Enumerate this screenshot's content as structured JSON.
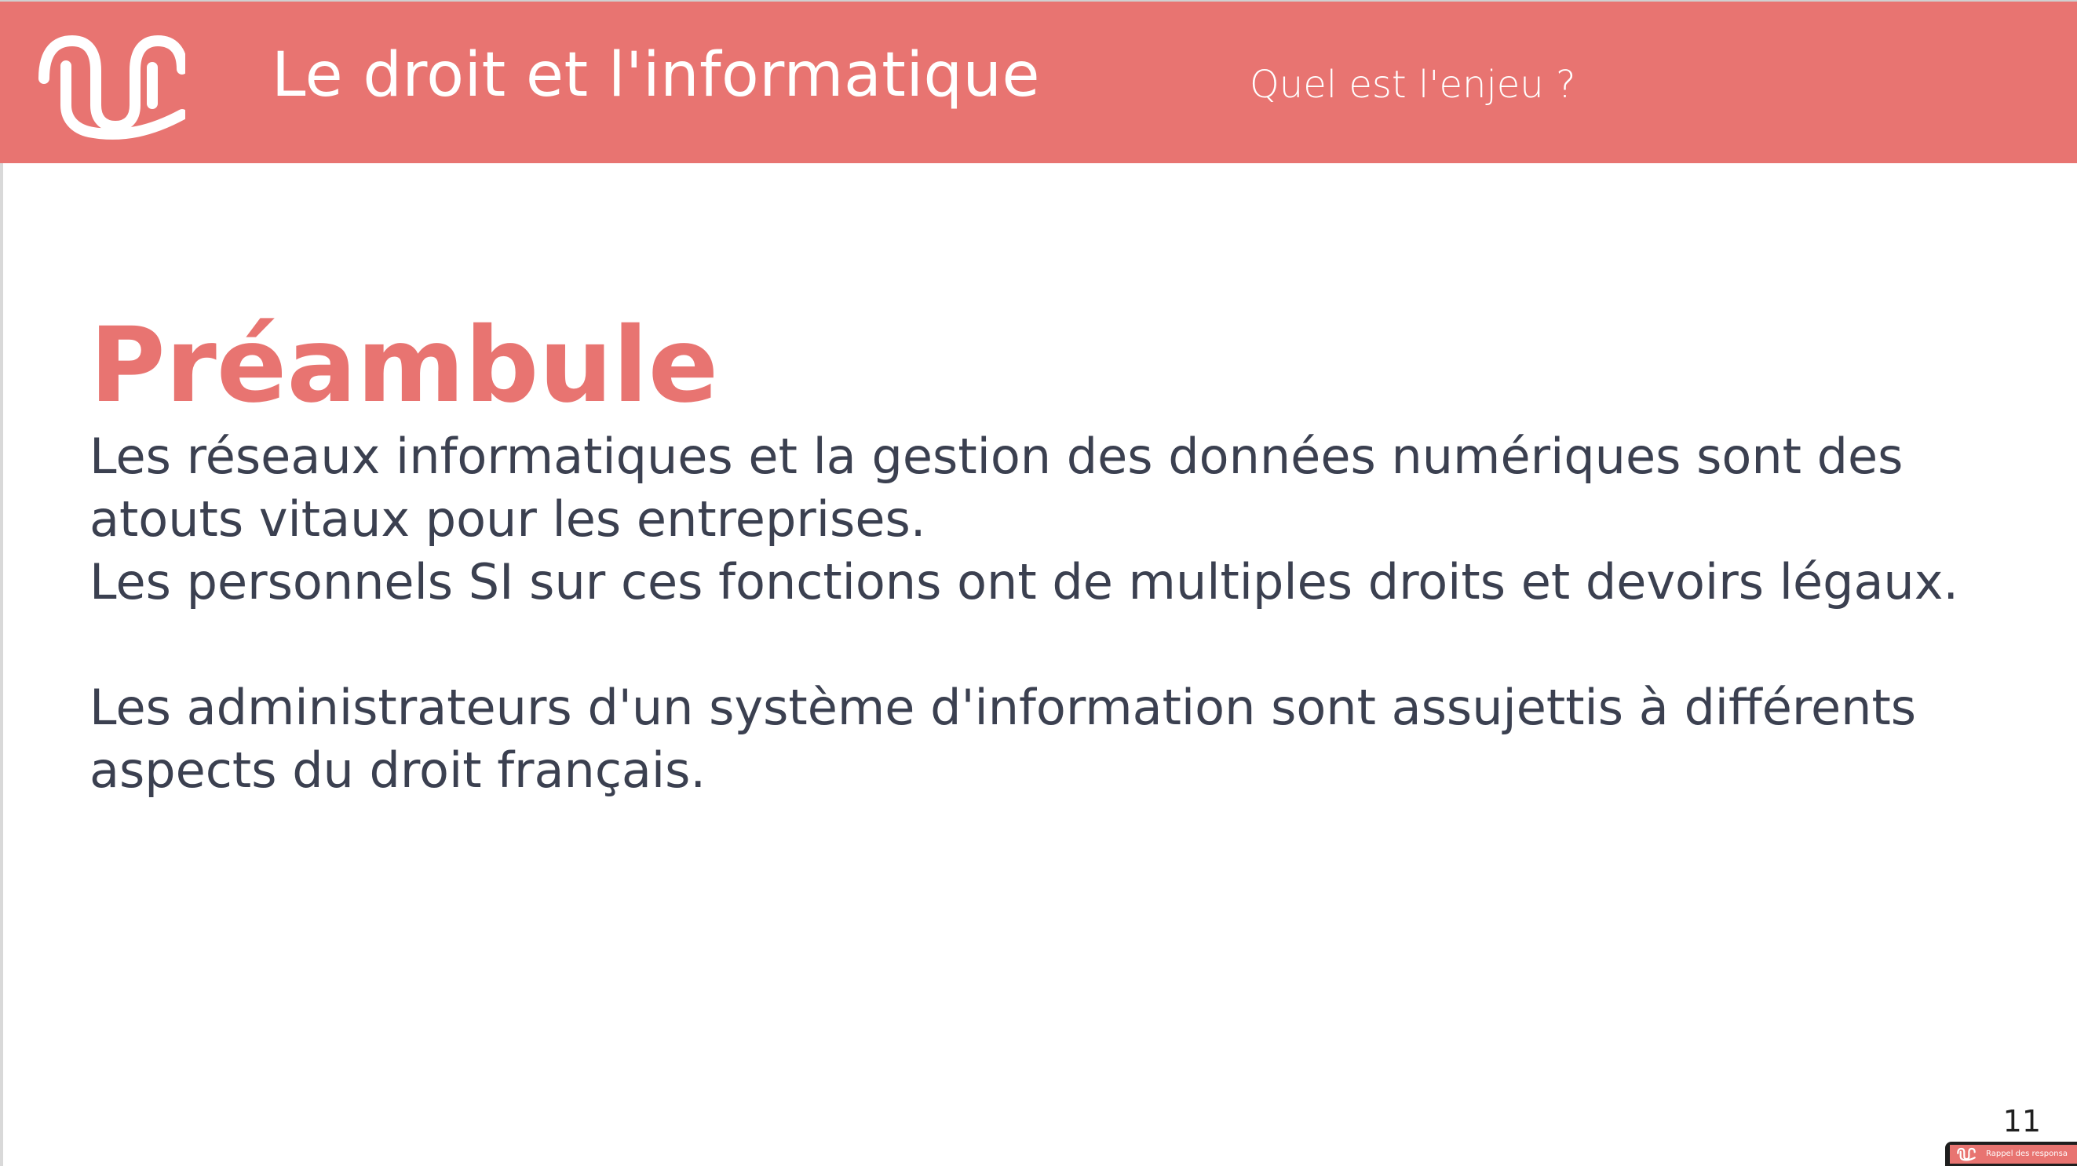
{
  "header": {
    "title": "Le droit et l'informatique",
    "section": "Quel est l'enjeu ?",
    "logo_icon": "wave-logo-icon",
    "background_color": "#e87471"
  },
  "slide": {
    "heading": "Préambule",
    "paragraphs": [
      "Les réseaux informatiques et la gestion des données numériques sont des atouts vitaux pour les entreprises.",
      "Les personnels SI sur ces fonctions ont de multiples droits et devoirs légaux.",
      "Les administrateurs d'un système d'information sont assujettis à différents aspects du droit français."
    ],
    "page_number": "11",
    "heading_color": "#e87471",
    "text_color": "#3b4050"
  },
  "thumbnail": {
    "label": "Rappel des responsa"
  }
}
